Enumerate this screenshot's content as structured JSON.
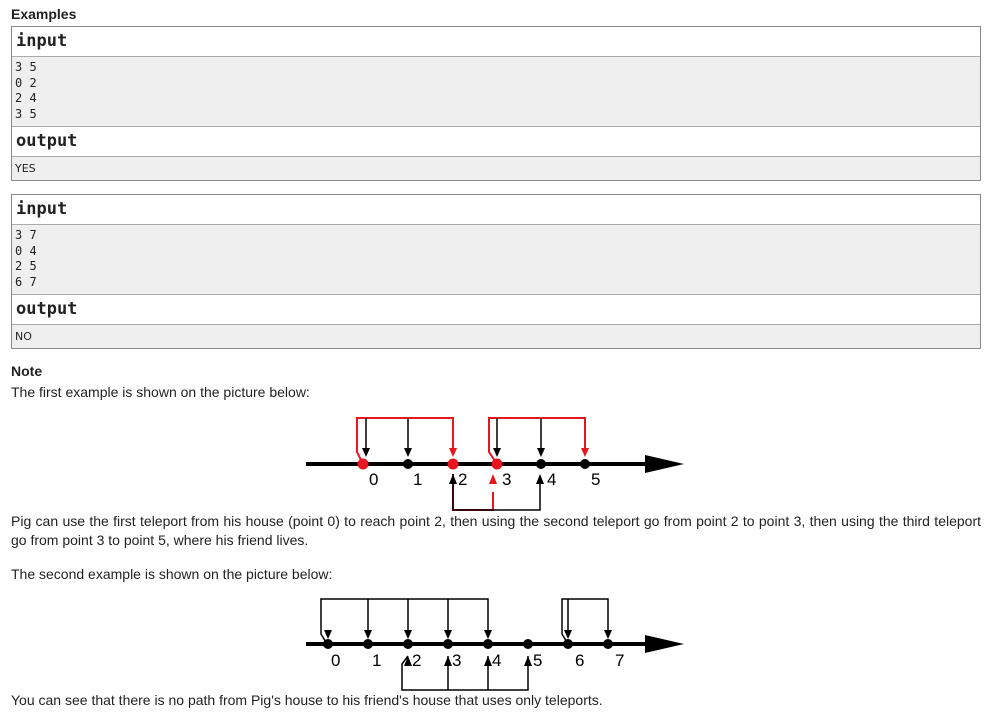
{
  "examples_title": "Examples",
  "samples": [
    {
      "input_label": "input",
      "input_lines": [
        "3 5",
        "0 2",
        "2 4",
        "3 5"
      ],
      "output_label": "output",
      "output_lines": [
        "YES"
      ]
    },
    {
      "input_label": "input",
      "input_lines": [
        "3 7",
        "0 4",
        "2 5",
        "6 7"
      ],
      "output_label": "output",
      "output_lines": [
        "NO"
      ]
    }
  ],
  "note": {
    "title": "Note",
    "intro_first": "The first example is shown on the picture below:",
    "explanation_first": "Pig can use the first teleport from his house (point 0) to reach point 2, then using the second teleport go from point 2 to point 3, then using the third teleport go from point 3 to point 5, where his friend lives.",
    "intro_second": "The second example is shown on the picture below:",
    "explanation_second": "You can see that there is no path from Pig's house to his friend's house that uses only teleports."
  },
  "diagram1": {
    "labels": [
      "0",
      "1",
      "2",
      "3",
      "4",
      "5"
    ],
    "red_points": [
      0,
      2,
      3
    ],
    "black_points": [
      1,
      4,
      5
    ],
    "colors": {
      "path": "#e8141e",
      "line": "#000000"
    }
  },
  "diagram2": {
    "labels": [
      "0",
      "1",
      "2",
      "3",
      "4",
      "5",
      "6",
      "7"
    ],
    "black_points": [
      0,
      1,
      2,
      3,
      4,
      5,
      6,
      7
    ],
    "colors": {
      "line": "#000000"
    }
  }
}
